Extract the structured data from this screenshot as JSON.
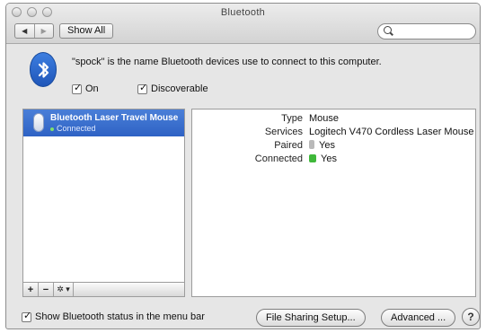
{
  "window": {
    "title": "Bluetooth"
  },
  "toolbar": {
    "back_icon": "chevron-left",
    "forward_icon": "chevron-right",
    "show_all_label": "Show All",
    "search_placeholder": "",
    "search_value": ""
  },
  "header": {
    "description": "\"spock\" is the name Bluetooth devices use to connect to this computer.",
    "on_label": "On",
    "on_checked": true,
    "discoverable_label": "Discoverable",
    "discoverable_checked": true
  },
  "devices": [
    {
      "name": "Bluetooth Laser Travel Mouse",
      "status": "Connected",
      "selected": true
    }
  ],
  "list_buttons": {
    "add": "+",
    "remove": "−",
    "action": "✲ ▾"
  },
  "details": {
    "rows": [
      {
        "label": "Type",
        "value": "Mouse"
      },
      {
        "label": "Services",
        "value": "Logitech V470 Cordless Laser Mouse"
      },
      {
        "label": "Paired",
        "value": "Yes"
      },
      {
        "label": "Connected",
        "value": "Yes"
      }
    ]
  },
  "footer": {
    "show_status_label": "Show Bluetooth status in the menu bar",
    "show_status_checked": true,
    "file_sharing_label": "File Sharing Setup...",
    "advanced_label": "Advanced ...",
    "help_label": "?"
  },
  "colors": {
    "selection": "#2e62c4",
    "connected_green": "#3fb83a",
    "bluetooth_blue": "#1f56b9"
  }
}
